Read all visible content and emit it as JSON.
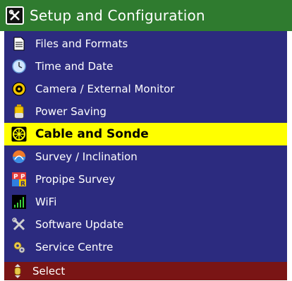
{
  "header": {
    "title": "Setup and Configuration",
    "icon": "wrench-screwdriver-icon"
  },
  "menu": {
    "items": [
      {
        "label": "Files and Formats",
        "icon": "document-icon"
      },
      {
        "label": "Time and Date",
        "icon": "clock-icon"
      },
      {
        "label": "Camera / External Monitor",
        "icon": "camera-icon"
      },
      {
        "label": "Power Saving",
        "icon": "battery-icon"
      },
      {
        "label": "Cable and Sonde",
        "icon": "cable-reel-icon",
        "selected": true
      },
      {
        "label": "Survey / Inclination",
        "icon": "survey-icon"
      },
      {
        "label": "Propipe Survey",
        "icon": "propipe-icon"
      },
      {
        "label": "WiFi",
        "icon": "wifi-icon"
      },
      {
        "label": "Software Update",
        "icon": "tools-icon"
      },
      {
        "label": "Service Centre",
        "icon": "gears-icon"
      }
    ]
  },
  "footer": {
    "label": "Select",
    "icon": "scroll-wheel-icon"
  },
  "colors": {
    "title_bar": "#2f7b2f",
    "menu_background": "#2c2b7f",
    "selected_highlight": "#ffff00",
    "footer_bar": "#7a1515"
  }
}
